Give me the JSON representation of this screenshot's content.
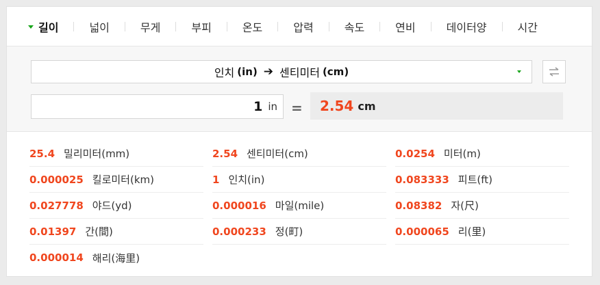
{
  "tabs": [
    {
      "label": "길이",
      "active": true
    },
    {
      "label": "넓이"
    },
    {
      "label": "무게"
    },
    {
      "label": "부피"
    },
    {
      "label": "온도"
    },
    {
      "label": "압력"
    },
    {
      "label": "속도"
    },
    {
      "label": "연비"
    },
    {
      "label": "데이터양"
    },
    {
      "label": "시간"
    }
  ],
  "converter": {
    "from_name": "인치",
    "from_code": "(in)",
    "arrow": "➔",
    "to_name": "센티미터",
    "to_code": "(cm)",
    "input_value": "1",
    "input_unit": "in",
    "equals": "=",
    "result_value": "2.54",
    "result_unit": "cm"
  },
  "results": [
    {
      "value": "25.4",
      "unit": "밀리미터(mm)"
    },
    {
      "value": "2.54",
      "unit": "센티미터(cm)"
    },
    {
      "value": "0.0254",
      "unit": "미터(m)"
    },
    {
      "value": "0.000025",
      "unit": "킬로미터(km)"
    },
    {
      "value": "1",
      "unit": "인치(in)"
    },
    {
      "value": "0.083333",
      "unit": "피트(ft)"
    },
    {
      "value": "0.027778",
      "unit": "야드(yd)"
    },
    {
      "value": "0.000016",
      "unit": "마일(mile)"
    },
    {
      "value": "0.08382",
      "unit": "자(尺)"
    },
    {
      "value": "0.01397",
      "unit": "간(間)"
    },
    {
      "value": "0.000233",
      "unit": "정(町)"
    },
    {
      "value": "0.000065",
      "unit": "리(里)"
    },
    {
      "value": "0.000014",
      "unit": "해리(海里)"
    }
  ],
  "colors": {
    "accent": "#f0461e",
    "marker": "#19a51b"
  }
}
